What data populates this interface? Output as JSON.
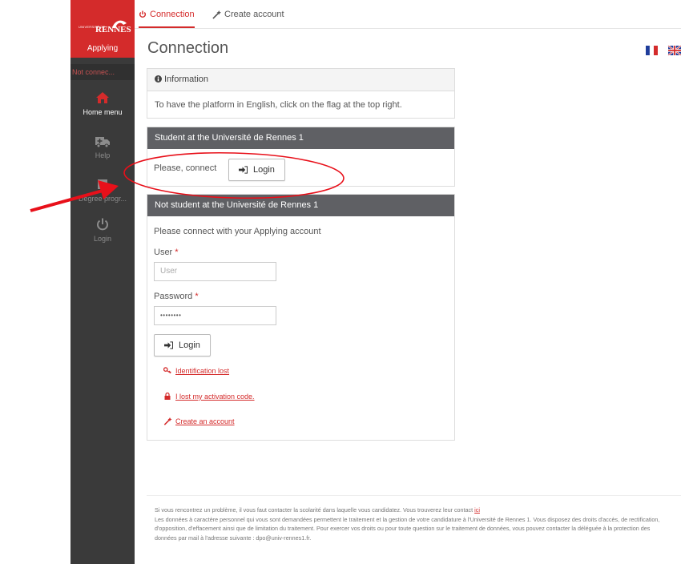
{
  "sidebar": {
    "logo": {
      "small": "UNIVERSITÉ DE",
      "big": "RENNES",
      "mark": "1"
    },
    "app_name": "Applying",
    "status": "Not connec...",
    "items": [
      {
        "label": "Home menu",
        "icon": "home-icon"
      },
      {
        "label": "Help",
        "icon": "ambulance-icon"
      },
      {
        "label": "Degree progr...",
        "icon": "degree-icon"
      },
      {
        "label": "Login",
        "icon": "power-icon"
      }
    ]
  },
  "tabs": [
    {
      "label": "Connection",
      "icon": "power-icon"
    },
    {
      "label": "Create account",
      "icon": "magic-wand-icon"
    }
  ],
  "page": {
    "title": "Connection"
  },
  "info_panel": {
    "title": "Information",
    "text": "To have the platform in English, click on the flag at the top right."
  },
  "student_panel": {
    "title": "Student at the Université de Rennes 1",
    "prompt": "Please, connect",
    "login_button": "Login"
  },
  "non_student_panel": {
    "title": "Not student at the Université de Rennes 1",
    "intro": "Please connect with your Applying account",
    "user_label": "User",
    "user_placeholder": "User",
    "password_label": "Password",
    "password_value": "••••••••",
    "required_mark": "*",
    "login_button": "Login",
    "links": [
      {
        "label": "Identification lost",
        "icon": "key-icon"
      },
      {
        "label": "I lost my activation code.",
        "icon": "lock-icon"
      },
      {
        "label": "Create an account",
        "icon": "magic-wand-icon"
      }
    ]
  },
  "footer": {
    "line1": "Si vous rencontrez un problème, il vous faut contacter la scolarité dans laquelle vous candidatez. Vous trouverez leur contact",
    "line1_link": "ici",
    "line2": "Les données à caractère personnel qui vous sont demandées permettent le traitement et la gestion de votre candidature à l'Université de Rennes 1. Vous disposez des droits d'accès, de rectification, d'opposition, d'effacement ainsi que de limitation du traitement. Pour exercer vos droits ou pour toute question sur le traitement de données, vous pouvez contacter la déléguée à la protection des données par mail à l'adresse suivante : dpo@univ-rennes1.fr."
  },
  "colors": {
    "accent": "#d42b2b",
    "sidebar": "#3a3a3a",
    "panel_header_dark": "#5f6064",
    "annotation": "#e8101a"
  }
}
